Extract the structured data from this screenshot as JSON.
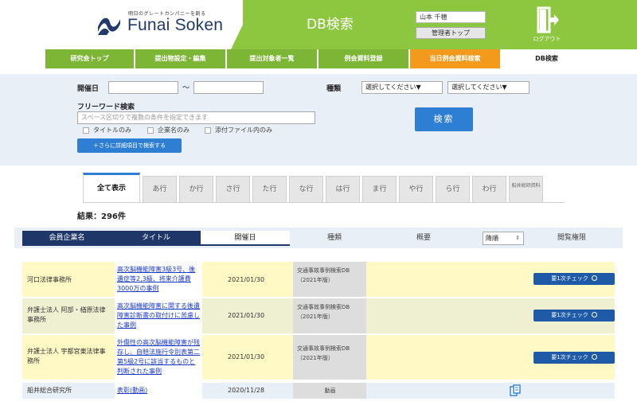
{
  "header": {
    "tagline": "明日のグレートカンパニーを創る",
    "brand": "Funai Soken",
    "page_title": "DB検索",
    "user_name": "山本 千穂",
    "admin_button": "管理者トップ",
    "logout_label": "ログアウト"
  },
  "nav": {
    "items": [
      {
        "label": "研究会トップ"
      },
      {
        "label": "提出物設定・編集"
      },
      {
        "label": "提出対象者一覧"
      },
      {
        "label": "例会資料登録"
      },
      {
        "label": "当日例会資料検索"
      },
      {
        "label": "DB検索"
      }
    ]
  },
  "search": {
    "date_label": "開催日",
    "date_from": "",
    "tilde": "〜",
    "date_to": "",
    "type_label": "種類",
    "type_select_1": "選択してください▼",
    "type_select_2": "選択してください▼",
    "freeword_label": "フリーワード検索",
    "freeword_placeholder": "スペース区切りで複数の条件を指定できます",
    "check_title": "タイトルのみ",
    "check_company": "企業名のみ",
    "check_attachment": "添付ファイル内のみ",
    "detail_button": "＋さらに詳細項目で検索する",
    "search_button": "検索"
  },
  "tabs": [
    {
      "label": "全て表示"
    },
    {
      "label": "あ行"
    },
    {
      "label": "か行"
    },
    {
      "label": "さ行"
    },
    {
      "label": "た行"
    },
    {
      "label": "な行"
    },
    {
      "label": "は行"
    },
    {
      "label": "ま行"
    },
    {
      "label": "や行"
    },
    {
      "label": "ら行"
    },
    {
      "label": "わ行"
    },
    {
      "label": "船井総研資料"
    }
  ],
  "result_text": "結果：296件",
  "table": {
    "headers": {
      "company": "会員企業名",
      "title": "タイトル",
      "date": "開催日",
      "type": "種類",
      "summary": "概要",
      "sort": "降順",
      "permission": "閲覧権限"
    },
    "rows": [
      {
        "company": "河口法律事務所",
        "title": "高次脳機能障害3級3号、後遺症等2,3級、将来介護費3000万の事例",
        "date": "2021/01/30",
        "type": "交通事故事例検索DB（2021年版）",
        "action": "要1次チェック"
      },
      {
        "company": "弁護士法人 阿部・楢原法律事務所",
        "title": "高次脳機能障害に関する後遺障害診断書の取付けに苦慮した事例",
        "date": "2021/01/30",
        "type": "交通事故事例検索DB（2021年版）",
        "action": "要1次チェック"
      },
      {
        "company": "弁護士法人 宇都宮東法律事務所",
        "title": "外傷性の高次脳機能障害が残存し、自賠法施行令別表第二第5級2号に該当するものと判断された事例",
        "date": "2021/01/30",
        "type": "交通事故事例検索DB（2021年版）",
        "action": "要1次チェック"
      },
      {
        "company": "船井総合研究所",
        "title": "表彰(動画)",
        "date": "2020/11/28",
        "type": "動画",
        "action": ""
      }
    ]
  }
}
